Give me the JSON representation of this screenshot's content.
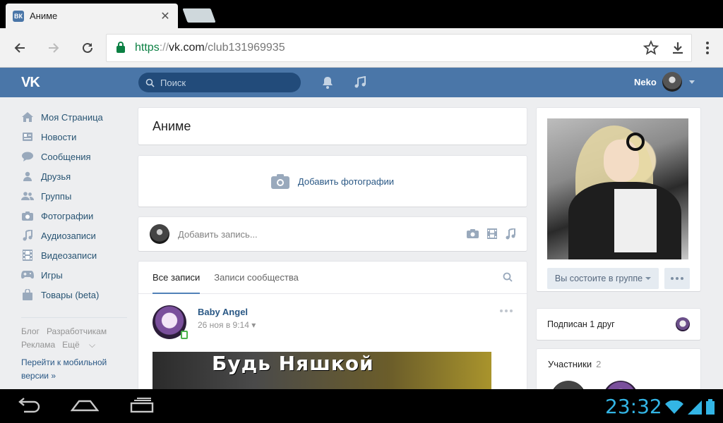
{
  "browser": {
    "tab_title": "Аниме",
    "tab_favicon": "ВК",
    "url_scheme": "https",
    "url_sep": "://",
    "url_host": "vk.com",
    "url_path": "/club131969935"
  },
  "header": {
    "logo": "VK",
    "search_placeholder": "Поиск",
    "user_name": "Neko",
    "accent_color": "#4a76a8"
  },
  "sidebar": {
    "items": [
      {
        "label": "Моя Страница",
        "icon": "home-icon"
      },
      {
        "label": "Новости",
        "icon": "news-icon"
      },
      {
        "label": "Сообщения",
        "icon": "messages-icon"
      },
      {
        "label": "Друзья",
        "icon": "friends-icon"
      },
      {
        "label": "Группы",
        "icon": "groups-icon"
      },
      {
        "label": "Фотографии",
        "icon": "camera-icon"
      },
      {
        "label": "Аудиозаписи",
        "icon": "music-icon"
      },
      {
        "label": "Видеозаписи",
        "icon": "film-icon"
      },
      {
        "label": "Игры",
        "icon": "gamepad-icon"
      },
      {
        "label": "Товары (beta)",
        "icon": "bag-icon"
      }
    ],
    "footer": {
      "blog": "Блог",
      "developers": "Разработчикам",
      "ads": "Реклама",
      "more": "Ещё",
      "mobile_line1": "Перейти к мобильной",
      "mobile_line2": "версии »"
    }
  },
  "group": {
    "title": "Аниме",
    "add_photos": "Добавить фотографии",
    "post_placeholder": "Добавить запись...",
    "wall_tabs": [
      "Все записи",
      "Записи сообщества"
    ],
    "member_button": "Вы состоите в группе",
    "friends_subscribed": "Подписан 1 друг",
    "members_title": "Участники",
    "members_count": "2"
  },
  "post": {
    "author": "Baby Angel",
    "date": "26 ноя в 9:14",
    "image_text": "Будь Няшкой"
  },
  "system": {
    "clock": "23:32",
    "clock_color": "#33b5e5"
  }
}
